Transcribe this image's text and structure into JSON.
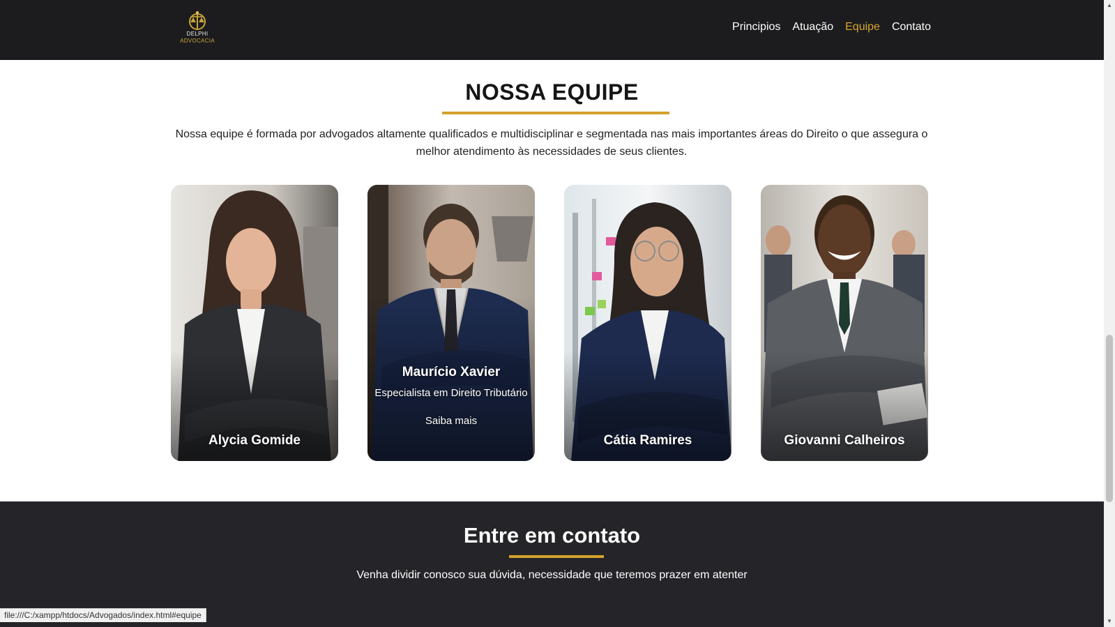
{
  "header": {
    "logo_line1": "DELPHI",
    "logo_line2": "ADVOCACIA",
    "nav": [
      {
        "label": "Principios"
      },
      {
        "label": "Atuação"
      },
      {
        "label": "Equipe",
        "active": true
      },
      {
        "label": "Contato"
      }
    ],
    "accent_color": "#d8a634"
  },
  "team": {
    "title": "NOSSA EQUIPE",
    "description": "Nossa equipe é formada por advogados altamente qualificados e multidisciplinar e segmentada nas mais importantes áreas do Direito o que assegura o melhor atendimento às necessidades de seus clientes.",
    "members": [
      {
        "name": "Alycia Gomide"
      },
      {
        "name": "Maurício Xavier",
        "role": "Especialista em Direito Tributário",
        "more": "Saiba mais"
      },
      {
        "name": "Cátia Ramires"
      },
      {
        "name": "Giovanni Calheiros"
      }
    ]
  },
  "contact": {
    "title": "Entre em contato",
    "description": "Venha dividir conosco sua dúvida, necessidade que teremos prazer em atenter"
  },
  "statusbar": {
    "url": "file:///C:/xampp/htdocs/Advogados/index.html#equipe"
  }
}
